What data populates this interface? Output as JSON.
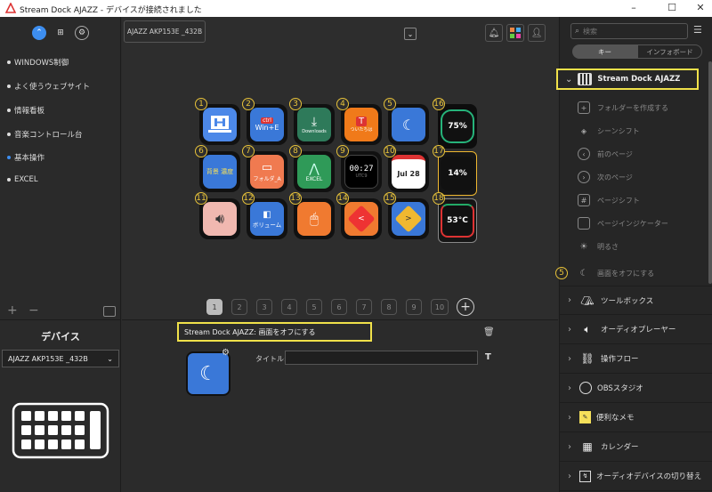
{
  "window": {
    "title": "Stream Dock AJAZZ - デバイスが接続されました"
  },
  "left": {
    "items": [
      {
        "label": "WINDOWS制御"
      },
      {
        "label": "よく使うウェブサイト"
      },
      {
        "label": "情報看板"
      },
      {
        "label": "音楽コントロール台"
      },
      {
        "label": "基本操作"
      },
      {
        "label": "EXCEL"
      }
    ],
    "device_heading": "デバイス",
    "device_select": "AJAZZ AKP153E _432B"
  },
  "center": {
    "device_tab": "AJAZZ AKP153E _432B",
    "pages": [
      "1",
      "2",
      "3",
      "4",
      "5",
      "6",
      "7",
      "8",
      "9",
      "10"
    ],
    "keys": [
      {
        "n": "1",
        "text": ""
      },
      {
        "n": "2",
        "text": "Win+E"
      },
      {
        "n": "3",
        "text": "Downloads"
      },
      {
        "n": "4",
        "text": "ついたちは"
      },
      {
        "n": "5",
        "text": ""
      },
      {
        "n": "16",
        "text": "75%"
      },
      {
        "n": "6",
        "text": "背景 濃度"
      },
      {
        "n": "7",
        "text": "フォルダ_A"
      },
      {
        "n": "8",
        "text": "EXCEL"
      },
      {
        "n": "9",
        "text": "00:27"
      },
      {
        "n": "10",
        "text": "Jul 28"
      },
      {
        "n": "17",
        "text": "14%"
      },
      {
        "n": "11",
        "text": ""
      },
      {
        "n": "12",
        "text": "ボリューム"
      },
      {
        "n": "13",
        "text": ""
      },
      {
        "n": "14",
        "text": "<"
      },
      {
        "n": "15",
        "text": ">"
      },
      {
        "n": "18",
        "text": "53°C"
      }
    ],
    "key_ctrl": "ctrl",
    "clock_sub": "UTC9",
    "breadcrumb": "Stream Dock AJAZZ: 画面をオフにする",
    "title_label": "タイトル:",
    "title_value": ""
  },
  "right": {
    "search_placeholder": "検索",
    "tab_keys": "キー",
    "tab_info": "インフォボード",
    "section_title": "Stream Dock AJAZZ",
    "sub_items": [
      {
        "label": "フォルダーを作成する"
      },
      {
        "label": "シーンシフト"
      },
      {
        "label": "前のページ"
      },
      {
        "label": "次のページ"
      },
      {
        "label": "ページシフト"
      },
      {
        "label": "ページインジケーター"
      },
      {
        "label": "明るさ"
      },
      {
        "label": "画面をオフにする",
        "badge": "5"
      }
    ],
    "categories": [
      {
        "label": "ツールボックス"
      },
      {
        "label": "オーディオプレーヤー"
      },
      {
        "label": "操作フロー"
      },
      {
        "label": "OBSスタジオ"
      },
      {
        "label": "便利なメモ"
      },
      {
        "label": "カレンダー"
      },
      {
        "label": "オーディオデバイスの切り替え"
      }
    ]
  }
}
